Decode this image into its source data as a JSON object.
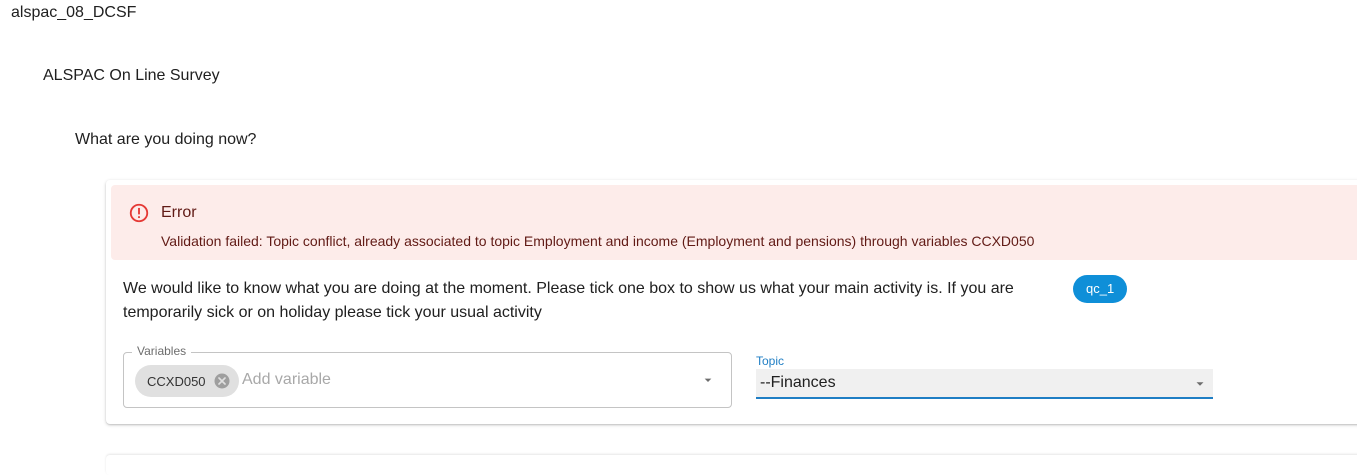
{
  "breadcrumbs": {
    "study": "alspac_08_DCSF",
    "survey": "ALSPAC On Line Survey",
    "section": "What are you doing now?"
  },
  "alert": {
    "title": "Error",
    "message": "Validation failed: Topic conflict, already associated to topic Employment and income (Employment and pensions) through variables CCXD050",
    "icon": "error-outline-icon"
  },
  "question": {
    "text": "We would like to know what you are doing at the moment. Please tick one box to show us what your main activity is. If you are temporarily sick or on holiday please tick your usual activity",
    "chip": "qc_1"
  },
  "variables": {
    "label": "Variables",
    "selected": [
      "CCXD050"
    ],
    "placeholder": "Add variable"
  },
  "topic": {
    "label": "Topic",
    "value": "--Finances"
  },
  "colors": {
    "error_bg": "#fdecea",
    "error_text": "#611a15",
    "error_icon": "#e53935",
    "accent": "#1f7ec4",
    "chip_blue": "#0f8fd8"
  }
}
